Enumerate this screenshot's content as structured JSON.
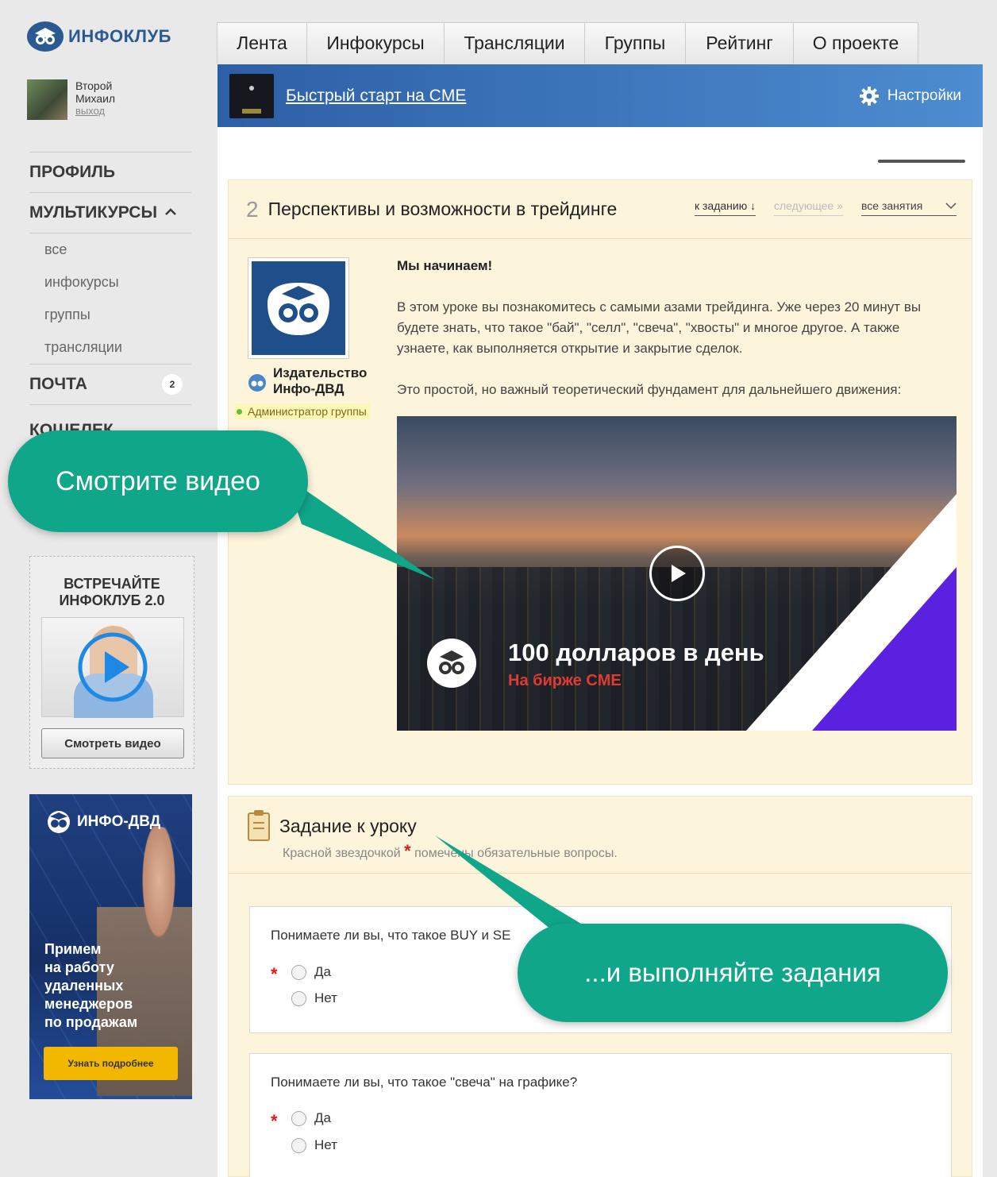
{
  "brand": {
    "name": "ИНФОКЛУБ"
  },
  "user": {
    "first": "Второй",
    "last": "Михаил",
    "logout": "выход"
  },
  "sidebar": {
    "profile": "ПРОФИЛЬ",
    "multicourses": "МУЛЬТИКУРСЫ",
    "sub": [
      "все",
      "инфокурсы",
      "группы",
      "трансляции"
    ],
    "mail": "ПОЧТА",
    "mail_count": "2",
    "wallet": "КОШЕЛЕК"
  },
  "promo1": {
    "title_line1": "ВСТРЕЧАЙТЕ",
    "title_line2": "ИНФОКЛУБ 2.0",
    "button": "Смотреть видео"
  },
  "promo2": {
    "brand": "ИНФО-ДВД",
    "text": [
      "Примем",
      "на работу",
      "удаленных",
      "менеджеров",
      "по продажам"
    ],
    "button": "Узнать подробнее"
  },
  "tabs": [
    "Лента",
    "Инфокурсы",
    "Трансляции",
    "Группы",
    "Рейтинг",
    "О проекте"
  ],
  "course": {
    "title": "Быстрый старт на CME",
    "settings": "Настройки"
  },
  "lesson": {
    "number": "2",
    "title": "Перспективы и возможности в трейдинге",
    "to_task": "к заданию ↓",
    "next": "следующее »",
    "all": "все занятия",
    "author_line1": "Издательство",
    "author_line2": "Инфо-ДВД",
    "author_role": "Администратор группы",
    "heading": "Мы начинаем!",
    "p1": "В этом уроке вы познакомитесь с самыми азами трейдинга. Уже через 20 минут вы будете знать, что такое \"бай\", \"селл\", \"свеча\", \"хвосты\" и многое другое. А также узнаете, как выполняется открытие и закрытие сделок.",
    "p2": "Это простой, но важный теоретический фундамент для дальнейшего движения:",
    "video_title": "100 долларов в день",
    "video_sub": "На бирже CME"
  },
  "task": {
    "title": "Задание к уроку",
    "note_before": "Красной звездочкой",
    "note_after": "помечены обязательные вопросы.",
    "q1": "Понимаете ли вы, что такое BUY и SE",
    "q2": "Понимаете ли вы, что такое \"свеча\" на графике?",
    "yes": "Да",
    "no": "Нет"
  },
  "callouts": {
    "video": "Смотрите видео",
    "tasks": "...и выполняйте задания"
  },
  "colors": {
    "accent": "#2d5fa6",
    "callout": "#10a689",
    "lesson_bg": "#fdf4dc",
    "required": "#d61c1c"
  }
}
